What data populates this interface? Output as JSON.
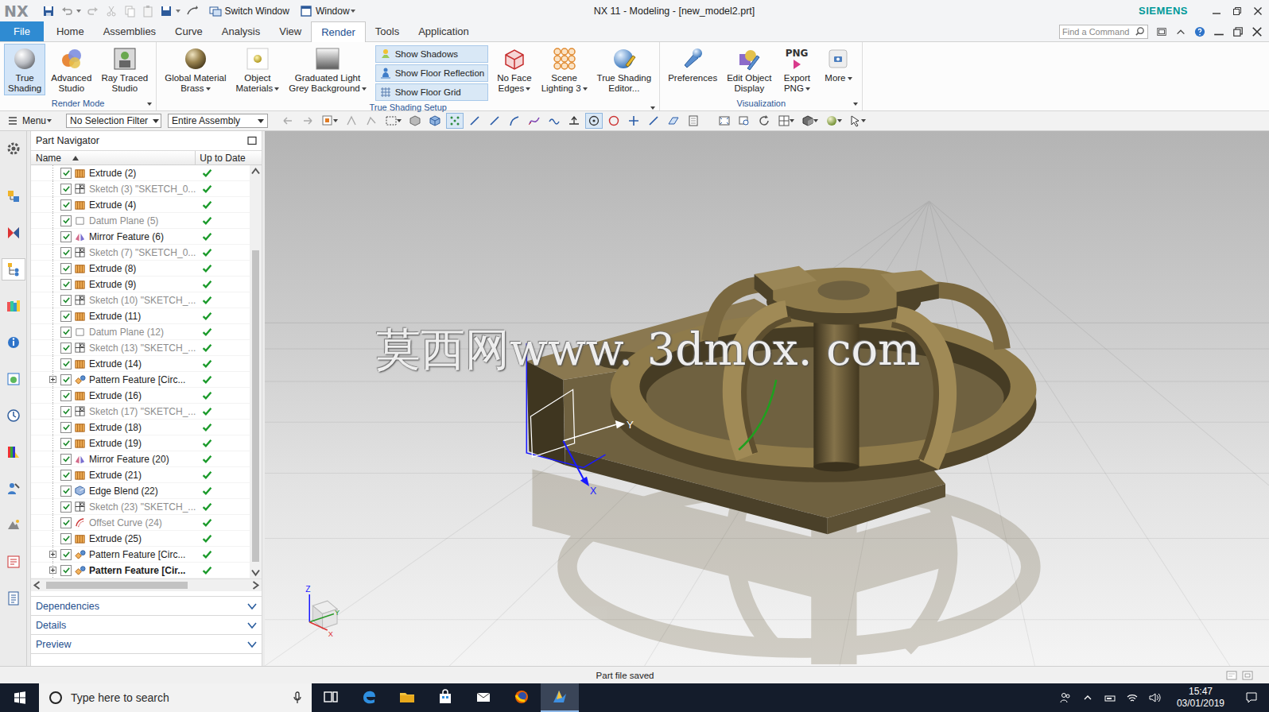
{
  "window": {
    "logo": "NX",
    "title": "NX 11 - Modeling - [new_model2.prt]",
    "brand": "SIEMENS",
    "quick_access": [
      {
        "label": "Switch Window",
        "icon": "switch-window",
        "dropdown": false
      },
      {
        "label": "Window",
        "icon": "window",
        "dropdown": true
      }
    ]
  },
  "ribbon": {
    "tabs": [
      {
        "label": "File",
        "kind": "file",
        "selected": false
      },
      {
        "label": "Home",
        "kind": "tab",
        "selected": false
      },
      {
        "label": "Assemblies",
        "kind": "tab",
        "selected": false
      },
      {
        "label": "Curve",
        "kind": "tab",
        "selected": false
      },
      {
        "label": "Analysis",
        "kind": "tab",
        "selected": false
      },
      {
        "label": "View",
        "kind": "tab",
        "selected": false
      },
      {
        "label": "Render",
        "kind": "tab",
        "selected": true
      },
      {
        "label": "Tools",
        "kind": "tab",
        "selected": false
      },
      {
        "label": "Application",
        "kind": "tab",
        "selected": false
      }
    ],
    "search": {
      "placeholder": "Find a Command"
    },
    "groups": [
      {
        "label": "Render Mode",
        "dropdown": true,
        "items": [
          {
            "kind": "large",
            "icon": "true-shading",
            "lines": [
              "True",
              "Shading"
            ],
            "selected": true,
            "dropdown": false
          },
          {
            "kind": "large",
            "icon": "advanced-studio",
            "lines": [
              "Advanced",
              "Studio"
            ],
            "selected": false,
            "dropdown": false
          },
          {
            "kind": "large",
            "icon": "ray-traced-studio",
            "lines": [
              "Ray Traced",
              "Studio"
            ],
            "selected": false,
            "dropdown": false
          }
        ]
      },
      {
        "label": "True Shading Setup",
        "dropdown": true,
        "items": [
          {
            "kind": "large",
            "icon": "global-material",
            "lines": [
              "Global Material",
              "Brass"
            ],
            "selected": false,
            "dropdown": true
          },
          {
            "kind": "large",
            "icon": "object-materials",
            "lines": [
              "Object",
              "Materials"
            ],
            "selected": false,
            "dropdown": true
          },
          {
            "kind": "large",
            "icon": "background",
            "lines": [
              "Graduated Light",
              "Grey Background"
            ],
            "selected": false,
            "dropdown": true
          },
          {
            "kind": "stack",
            "buttons": [
              {
                "label": "Show Shadows",
                "icon": "shadows",
                "selected": true
              },
              {
                "label": "Show Floor Reflection",
                "icon": "reflection",
                "selected": true
              },
              {
                "label": "Show Floor Grid",
                "icon": "grid",
                "selected": true
              }
            ]
          },
          {
            "kind": "large",
            "icon": "no-face-edges",
            "lines": [
              "No Face",
              "Edges"
            ],
            "selected": false,
            "dropdown": true
          },
          {
            "kind": "large",
            "icon": "scene-lighting",
            "lines": [
              "Scene",
              "Lighting 3"
            ],
            "selected": false,
            "dropdown": true
          },
          {
            "kind": "large",
            "icon": "shading-editor",
            "lines": [
              "True Shading",
              "Editor..."
            ],
            "selected": false,
            "dropdown": false
          }
        ]
      },
      {
        "label": "Visualization",
        "dropdown": true,
        "items": [
          {
            "kind": "large",
            "icon": "preferences",
            "lines": [
              "Preferences"
            ],
            "selected": false,
            "dropdown": false
          },
          {
            "kind": "large",
            "icon": "edit-object-display",
            "lines": [
              "Edit Object",
              "Display"
            ],
            "selected": false,
            "dropdown": false
          },
          {
            "kind": "large",
            "icon": "export-png",
            "icon_text": "PNG",
            "lines": [
              "Export",
              "PNG"
            ],
            "selected": false,
            "dropdown": true
          },
          {
            "kind": "large",
            "icon": "more",
            "lines": [
              "More"
            ],
            "selected": false,
            "dropdown": true
          }
        ]
      }
    ]
  },
  "toolbar": {
    "menu": {
      "label": "Menu",
      "dropdown": true
    },
    "filters": [
      {
        "value": "No Selection Filter"
      },
      {
        "value": "Entire Assembly"
      }
    ],
    "icons": [
      {
        "kind": "view-back",
        "selected": false,
        "dropdown": false
      },
      {
        "kind": "view-forward",
        "selected": false,
        "dropdown": false
      },
      {
        "kind": "select",
        "selected": false,
        "dropdown": true
      },
      {
        "kind": "wire",
        "selected": false,
        "dropdown": false
      },
      {
        "kind": "feature",
        "selected": false,
        "dropdown": false
      },
      {
        "kind": "rect-select",
        "selected": false,
        "dropdown": true
      },
      {
        "kind": "body",
        "selected": false,
        "dropdown": false
      },
      {
        "kind": "cube",
        "selected": false,
        "dropdown": false
      },
      {
        "kind": "points",
        "selected": true,
        "dropdown": false
      },
      {
        "kind": "line",
        "selected": false,
        "dropdown": false
      },
      {
        "kind": "line",
        "selected": false,
        "dropdown": false
      },
      {
        "kind": "curve",
        "selected": false,
        "dropdown": false
      },
      {
        "kind": "spline",
        "selected": false,
        "dropdown": false
      },
      {
        "kind": "wave",
        "selected": false,
        "dropdown": false
      },
      {
        "kind": "tangent",
        "selected": false,
        "dropdown": false
      },
      {
        "kind": "center",
        "selected": true,
        "dropdown": false
      },
      {
        "kind": "circle",
        "selected": false,
        "dropdown": false
      },
      {
        "kind": "plus",
        "selected": false,
        "dropdown": false
      },
      {
        "kind": "line",
        "selected": false,
        "dropdown": false
      },
      {
        "kind": "view",
        "selected": false,
        "dropdown": false
      },
      {
        "kind": "book",
        "selected": false,
        "dropdown": false
      },
      {
        "kind": "fit",
        "selected": false,
        "dropdown": false
      },
      {
        "kind": "zoom",
        "selected": false,
        "dropdown": false
      },
      {
        "kind": "rotate",
        "selected": false,
        "dropdown": false
      },
      {
        "kind": "layout",
        "selected": false,
        "dropdown": true
      },
      {
        "kind": "shade",
        "selected": false,
        "dropdown": true
      },
      {
        "kind": "sphere",
        "selected": false,
        "dropdown": true
      },
      {
        "kind": "arrow",
        "selected": false,
        "dropdown": true
      }
    ]
  },
  "resource_bar": {
    "items": [
      {
        "kind": "settings",
        "selected": false
      },
      {
        "kind": "assembly-navigator",
        "selected": false
      },
      {
        "kind": "constraint-navigator",
        "selected": false
      },
      {
        "kind": "part-navigator",
        "selected": true
      },
      {
        "kind": "reuse-library",
        "selected": false
      },
      {
        "kind": "hd3d",
        "selected": false
      },
      {
        "kind": "web-browser",
        "selected": false
      },
      {
        "kind": "history",
        "selected": false
      },
      {
        "kind": "palette",
        "selected": false
      },
      {
        "kind": "roles",
        "selected": false
      },
      {
        "kind": "system-scenes",
        "selected": false
      },
      {
        "kind": "process-studio",
        "selected": false
      },
      {
        "kind": "list",
        "selected": false
      }
    ]
  },
  "part_navigator": {
    "title": "Part Navigator",
    "columns": [
      {
        "label": "Name",
        "sorted": true
      },
      {
        "label": "Up to Date",
        "sorted": false
      }
    ],
    "rows": [
      {
        "name": "Extrude (2)",
        "kind": "extrude",
        "checked": true,
        "greyed": false,
        "current": false,
        "expandable": false,
        "expanded": false,
        "up_to_date": true
      },
      {
        "name": "Sketch (3) \"SKETCH_0...",
        "kind": "sketch",
        "checked": true,
        "greyed": true,
        "current": false,
        "expandable": false,
        "expanded": false,
        "up_to_date": true
      },
      {
        "name": "Extrude (4)",
        "kind": "extrude",
        "checked": true,
        "greyed": false,
        "current": false,
        "expandable": false,
        "expanded": false,
        "up_to_date": true
      },
      {
        "name": "Datum Plane (5)",
        "kind": "datum",
        "checked": true,
        "greyed": true,
        "current": false,
        "expandable": false,
        "expanded": false,
        "up_to_date": true
      },
      {
        "name": "Mirror Feature (6)",
        "kind": "mirror",
        "checked": true,
        "greyed": false,
        "current": false,
        "expandable": false,
        "expanded": false,
        "up_to_date": true
      },
      {
        "name": "Sketch (7) \"SKETCH_0...",
        "kind": "sketch",
        "checked": true,
        "greyed": true,
        "current": false,
        "expandable": false,
        "expanded": false,
        "up_to_date": true
      },
      {
        "name": "Extrude (8)",
        "kind": "extrude",
        "checked": true,
        "greyed": false,
        "current": false,
        "expandable": false,
        "expanded": false,
        "up_to_date": true
      },
      {
        "name": "Extrude (9)",
        "kind": "extrude",
        "checked": true,
        "greyed": false,
        "current": false,
        "expandable": false,
        "expanded": false,
        "up_to_date": true
      },
      {
        "name": "Sketch (10) \"SKETCH_...",
        "kind": "sketch",
        "checked": true,
        "greyed": true,
        "current": false,
        "expandable": false,
        "expanded": false,
        "up_to_date": true
      },
      {
        "name": "Extrude (11)",
        "kind": "extrude",
        "checked": true,
        "greyed": false,
        "current": false,
        "expandable": false,
        "expanded": false,
        "up_to_date": true
      },
      {
        "name": "Datum Plane (12)",
        "kind": "datum",
        "checked": true,
        "greyed": true,
        "current": false,
        "expandable": false,
        "expanded": false,
        "up_to_date": true
      },
      {
        "name": "Sketch (13) \"SKETCH_...",
        "kind": "sketch",
        "checked": true,
        "greyed": true,
        "current": false,
        "expandable": false,
        "expanded": false,
        "up_to_date": true
      },
      {
        "name": "Extrude (14)",
        "kind": "extrude",
        "checked": true,
        "greyed": false,
        "current": false,
        "expandable": false,
        "expanded": false,
        "up_to_date": true
      },
      {
        "name": "Pattern Feature [Circ...",
        "kind": "pattern",
        "checked": true,
        "greyed": false,
        "current": false,
        "expandable": true,
        "expanded": false,
        "up_to_date": true
      },
      {
        "name": "Extrude (16)",
        "kind": "extrude",
        "checked": true,
        "greyed": false,
        "current": false,
        "expandable": false,
        "expanded": false,
        "up_to_date": true
      },
      {
        "name": "Sketch (17) \"SKETCH_...",
        "kind": "sketch",
        "checked": true,
        "greyed": true,
        "current": false,
        "expandable": false,
        "expanded": false,
        "up_to_date": true
      },
      {
        "name": "Extrude (18)",
        "kind": "extrude",
        "checked": true,
        "greyed": false,
        "current": false,
        "expandable": false,
        "expanded": false,
        "up_to_date": true
      },
      {
        "name": "Extrude (19)",
        "kind": "extrude",
        "checked": true,
        "greyed": false,
        "current": false,
        "expandable": false,
        "expanded": false,
        "up_to_date": true
      },
      {
        "name": "Mirror Feature (20)",
        "kind": "mirror",
        "checked": true,
        "greyed": false,
        "current": false,
        "expandable": false,
        "expanded": false,
        "up_to_date": true
      },
      {
        "name": "Extrude (21)",
        "kind": "extrude",
        "checked": true,
        "greyed": false,
        "current": false,
        "expandable": false,
        "expanded": false,
        "up_to_date": true
      },
      {
        "name": "Edge Blend (22)",
        "kind": "blend",
        "checked": true,
        "greyed": false,
        "current": false,
        "expandable": false,
        "expanded": false,
        "up_to_date": true
      },
      {
        "name": "Sketch (23) \"SKETCH_...",
        "kind": "sketch",
        "checked": true,
        "greyed": true,
        "current": false,
        "expandable": false,
        "expanded": false,
        "up_to_date": true
      },
      {
        "name": "Offset Curve (24)",
        "kind": "offset",
        "checked": true,
        "greyed": true,
        "current": false,
        "expandable": false,
        "expanded": false,
        "up_to_date": true
      },
      {
        "name": "Extrude (25)",
        "kind": "extrude",
        "checked": true,
        "greyed": false,
        "current": false,
        "expandable": false,
        "expanded": false,
        "up_to_date": true
      },
      {
        "name": "Pattern Feature [Circ...",
        "kind": "pattern",
        "checked": true,
        "greyed": false,
        "current": false,
        "expandable": true,
        "expanded": false,
        "up_to_date": true
      },
      {
        "name": "Pattern Feature [Cir...",
        "kind": "pattern",
        "checked": true,
        "greyed": false,
        "current": true,
        "expandable": true,
        "expanded": false,
        "up_to_date": true
      }
    ],
    "sections": [
      {
        "label": "Dependencies",
        "expanded": false
      },
      {
        "label": "Details",
        "expanded": false
      },
      {
        "label": "Preview",
        "expanded": false
      }
    ]
  },
  "viewport": {
    "watermark": "莫西网www. 3dmox. com",
    "triad": {
      "labels": [
        "Y",
        "X"
      ]
    },
    "mini_triad": {
      "labels": [
        "Z",
        "Y",
        "X"
      ]
    }
  },
  "status_bar": {
    "message": "Part file saved"
  },
  "taskbar": {
    "search": {
      "placeholder": "Type here to search"
    },
    "apps": [
      {
        "kind": "task-view",
        "selected": false
      },
      {
        "kind": "edge",
        "selected": false
      },
      {
        "kind": "explorer",
        "selected": false
      },
      {
        "kind": "store",
        "selected": false
      },
      {
        "kind": "mail",
        "selected": false
      },
      {
        "kind": "firefox",
        "selected": false
      },
      {
        "kind": "nx",
        "selected": true
      }
    ],
    "tray": {
      "time": "15:47",
      "date": "03/01/2019"
    }
  }
}
